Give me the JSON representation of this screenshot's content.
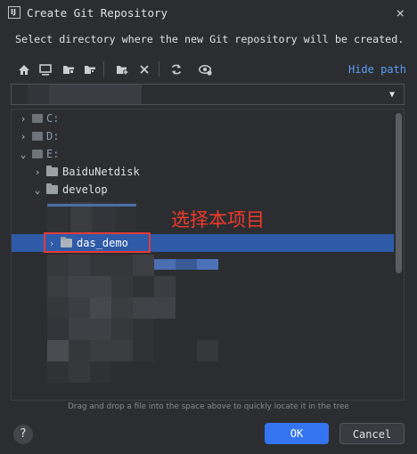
{
  "window": {
    "title": "Create Git Repository",
    "close_icon": "×"
  },
  "description": "Select directory where the new Git repository will be created.",
  "toolbar": {
    "icons": [
      "home-icon",
      "desktop-icon",
      "project-folder-icon",
      "module-folder-icon",
      "new-folder-icon",
      "delete-icon",
      "refresh-icon",
      "show-hidden-icon"
    ],
    "hide_path_label": "Hide path"
  },
  "tree": {
    "items": [
      {
        "label": "C:",
        "arrow": "›"
      },
      {
        "label": "D:",
        "arrow": "›"
      },
      {
        "label": "E:",
        "arrow": "⌄"
      },
      {
        "label": "BaiduNetdisk",
        "arrow": "›"
      },
      {
        "label": "develop",
        "arrow": "⌄"
      },
      {
        "label": "das_demo",
        "arrow": "›",
        "selected": true
      }
    ]
  },
  "annotation": "选择本项目",
  "hint": "Drag and drop a file into the space above to quickly locate it in the tree",
  "buttons": {
    "help": "?",
    "ok": "OK",
    "cancel": "Cancel"
  },
  "colors": {
    "accent": "#3574f0",
    "selection": "#2e5aa8",
    "annotation": "#f0392a",
    "link": "#589df6"
  }
}
